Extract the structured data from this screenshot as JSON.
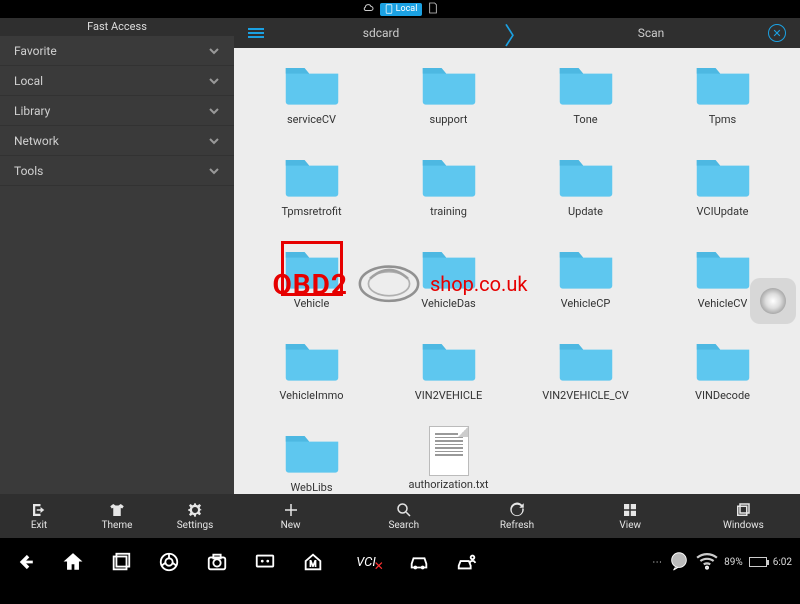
{
  "statusbar": {
    "local_label": "Local"
  },
  "sidebar": {
    "title": "Fast Access",
    "items": [
      {
        "label": "Favorite"
      },
      {
        "label": "Local"
      },
      {
        "label": "Library"
      },
      {
        "label": "Network"
      },
      {
        "label": "Tools"
      }
    ],
    "bottom": {
      "exit": "Exit",
      "theme": "Theme",
      "settings": "Settings"
    }
  },
  "header": {
    "path1": "sdcard",
    "path2": "Scan"
  },
  "folders": [
    {
      "name": "serviceCV",
      "type": "folder"
    },
    {
      "name": "support",
      "type": "folder"
    },
    {
      "name": "Tone",
      "type": "folder"
    },
    {
      "name": "Tpms",
      "type": "folder"
    },
    {
      "name": "Tpmsretrofit",
      "type": "folder"
    },
    {
      "name": "training",
      "type": "folder"
    },
    {
      "name": "Update",
      "type": "folder"
    },
    {
      "name": "VCIUpdate",
      "type": "folder"
    },
    {
      "name": "Vehicle",
      "type": "folder",
      "highlighted": true
    },
    {
      "name": "VehicleDas",
      "type": "folder"
    },
    {
      "name": "VehicleCP",
      "type": "folder"
    },
    {
      "name": "VehicleCV",
      "type": "folder"
    },
    {
      "name": "VehicleImmo",
      "type": "folder"
    },
    {
      "name": "VIN2VEHICLE",
      "type": "folder"
    },
    {
      "name": "VIN2VEHICLE_CV",
      "type": "folder"
    },
    {
      "name": "VINDecode",
      "type": "folder"
    },
    {
      "name": "WebLibs",
      "type": "folder"
    },
    {
      "name": "authorization.txt",
      "type": "file"
    }
  ],
  "content_bottom": {
    "new": "New",
    "search": "Search",
    "refresh": "Refresh",
    "view": "View",
    "windows": "Windows"
  },
  "watermark": {
    "part1": "OBD2",
    "part2": "shop.co.uk"
  },
  "os_status": {
    "wifi_pct": "89%",
    "time": "6:02"
  }
}
